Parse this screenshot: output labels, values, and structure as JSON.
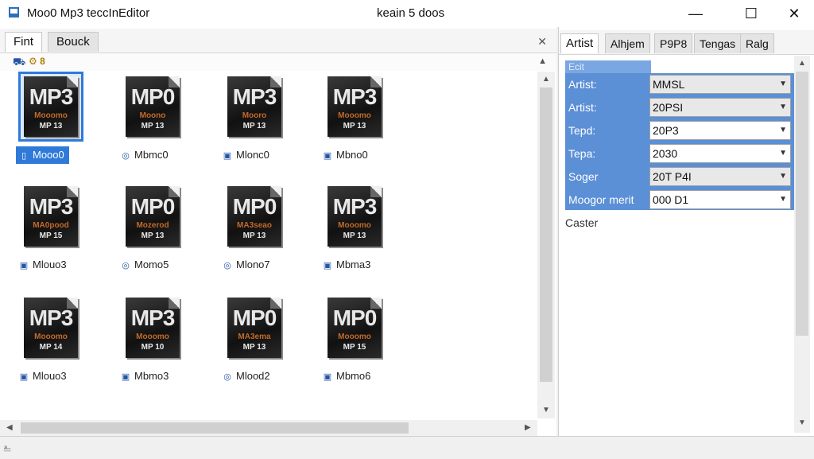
{
  "window": {
    "title": "Moo0 Mp3 teccInEditor",
    "center_title": "keain 5 doos",
    "minimize": "—",
    "maximize": "☐",
    "close": "✕"
  },
  "left_tabs": [
    {
      "label": "Fint",
      "active": true
    },
    {
      "label": "Bouck",
      "active": false
    }
  ],
  "pane_close": "✕",
  "subbar": {
    "text": "⚙ 8"
  },
  "tiles": [
    {
      "big": "MP3",
      "mid": "Mooomo",
      "small": "MP 13",
      "caption": "Mooo0",
      "selected": true,
      "cap_icon": "▯"
    },
    {
      "big": "MP0",
      "mid": "Moono",
      "small": "MP 13",
      "caption": "Mbmc0",
      "selected": false,
      "cap_icon": "◎"
    },
    {
      "big": "MP3",
      "mid": "Mooro",
      "small": "MP 13",
      "caption": "Mlonc0",
      "selected": false,
      "cap_icon": "▣"
    },
    {
      "big": "MP3",
      "mid": "Mooomo",
      "small": "MP 13",
      "caption": "Mbno0",
      "selected": false,
      "cap_icon": "▣"
    },
    {
      "big": "MP3",
      "mid": "MA0pood",
      "small": "MP 15",
      "caption": "Mlouo3",
      "selected": false,
      "cap_icon": "▣"
    },
    {
      "big": "MP0",
      "mid": "Mozerod",
      "small": "MP 13",
      "caption": "Momo5",
      "selected": false,
      "cap_icon": "◎"
    },
    {
      "big": "MP0",
      "mid": "MA3seao",
      "small": "MP 13",
      "caption": "Mlono7",
      "selected": false,
      "cap_icon": "◎"
    },
    {
      "big": "MP3",
      "mid": "Mooomo",
      "small": "MP 13",
      "caption": "Mbma3",
      "selected": false,
      "cap_icon": "▣"
    },
    {
      "big": "MP3",
      "mid": "Mooomo",
      "small": "MP 14",
      "caption": "Mlouo3",
      "selected": false,
      "cap_icon": "▣"
    },
    {
      "big": "MP3",
      "mid": "Mooomo",
      "small": "MP 10",
      "caption": "Mbmo3",
      "selected": false,
      "cap_icon": "▣"
    },
    {
      "big": "MP0",
      "mid": "MA3ema",
      "small": "MP 13",
      "caption": "Mlood2",
      "selected": false,
      "cap_icon": "◎"
    },
    {
      "big": "MP0",
      "mid": "Mooomo",
      "small": "MP 15",
      "caption": "Mbmo6",
      "selected": false,
      "cap_icon": "▣"
    }
  ],
  "right_tabs": [
    {
      "label": "Artist",
      "active": true
    },
    {
      "label": "Alhjem",
      "active": false
    },
    {
      "label": "P9P8",
      "active": false
    },
    {
      "label": "Tengas",
      "active": false
    },
    {
      "label": "Ralg",
      "active": false
    }
  ],
  "edit_header": "Ecit",
  "fields": [
    {
      "label": "Artist:",
      "value": "MMSL",
      "grey": true
    },
    {
      "label": "Artist:",
      "value": "20PSI",
      "grey": true
    },
    {
      "label": "Tepd:",
      "value": "20P3",
      "grey": false
    },
    {
      "label": "Tepa:",
      "value": "2030",
      "grey": false
    },
    {
      "label": "Soger",
      "value": "20T P4I",
      "grey": true
    },
    {
      "label": "Moogor merit",
      "value": "000 D1",
      "grey": false
    }
  ],
  "cancel_text": "Caster",
  "dropdown_glyph": "▼",
  "status_icon": "⎁"
}
